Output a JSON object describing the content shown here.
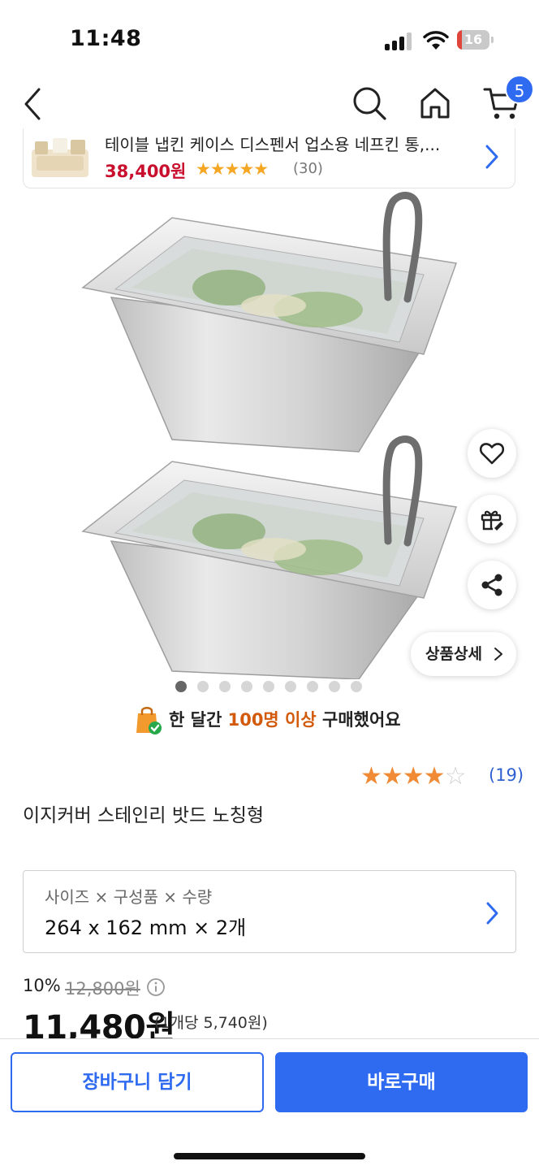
{
  "status_bar": {
    "time": "11:48",
    "battery_level": "16",
    "battery_fraction": 0.16,
    "signal_bars_active": 3,
    "signal_bars_total": 4
  },
  "nav": {
    "back_icon": "chevron-left-icon",
    "search_icon": "search-icon",
    "home_icon": "home-icon",
    "cart_icon": "cart-icon",
    "cart_count": "5"
  },
  "recommended": {
    "title": "테이블 냅킨 케이스 디스펜서 업소용 네프킨 통,...",
    "price": "38,400원",
    "stars": "★★★★★",
    "rating_value": 4.5,
    "review_count": "(30)"
  },
  "gallery": {
    "image_count": 9,
    "active_index": 0
  },
  "actions": {
    "wishlist_icon": "heart-icon",
    "gift_icon": "gift-icon",
    "share_icon": "share-icon",
    "detail_label": "상품상세"
  },
  "purchase_note": {
    "prefix": "한 달간 ",
    "highlight": "100명 이상",
    "suffix": " 구매했어요"
  },
  "rating": {
    "filled_stars": "★★★★",
    "empty_stars": "☆",
    "value": 4,
    "count": "(19)"
  },
  "product": {
    "title": "이지커버 스테인리 밧드 노칭형"
  },
  "option": {
    "label": "사이즈 × 구성품 × 수량",
    "value": "264 x 162 mm × 2개"
  },
  "price": {
    "discount": "10%",
    "original": "12,800원",
    "sale": "11,480원",
    "unit_price": "(1개당 5,740원)"
  },
  "bottom": {
    "cart_button": "장바구니 담기",
    "buy_button": "바로구매"
  },
  "colors": {
    "accent_blue": "#2f6bf0",
    "price_red": "#c8102e",
    "star_orange": "#f08a34",
    "highlight_orange": "#d25a0a"
  }
}
